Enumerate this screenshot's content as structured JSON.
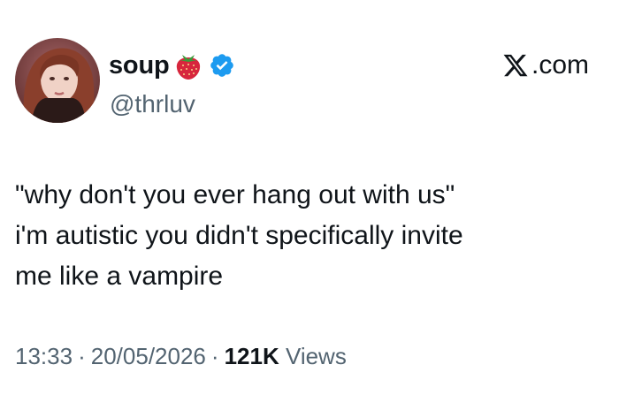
{
  "author": {
    "display_name": "soup",
    "name_emoji": "strawberry-icon",
    "verified": "verified-badge-icon",
    "handle": "@thrluv"
  },
  "brand": {
    "logo": "x-logo-icon",
    "text": ".com"
  },
  "tweet": {
    "lines": [
      "\"why don't you ever hang out with us\"",
      "i'm autistic you didn't specifically invite",
      "me like a vampire"
    ]
  },
  "meta": {
    "time": "13:33",
    "separator": "·",
    "date": "20/05/2026",
    "views_count": "121K",
    "views_label": "Views"
  },
  "colors": {
    "text": "#0f1419",
    "secondary": "#536471",
    "verified_blue": "#1d9bf0",
    "strawberry_red": "#d7263d"
  }
}
